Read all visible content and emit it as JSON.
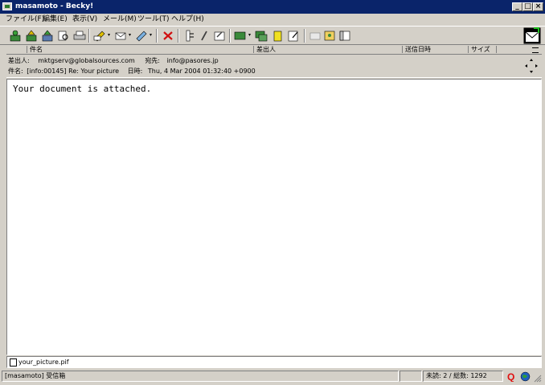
{
  "window": {
    "title": "masamoto - Becky!",
    "minimize_glyph": "_",
    "maximize_glyph": "□",
    "close_glyph": "×"
  },
  "menu": [
    {
      "label": "ファイル(F)"
    },
    {
      "label": "編集(E)"
    },
    {
      "label": "表示(V)"
    },
    {
      "label": "メール(M)"
    },
    {
      "label": "ツール(T)"
    },
    {
      "label": "ヘルプ(H)"
    }
  ],
  "toolbar": {
    "icons": [
      "receive-icon",
      "send-icon",
      "send-receive-icon",
      "print-preview-icon",
      "print-icon",
      "compose-icon",
      "reply-icon",
      "forward-icon",
      "delete-icon",
      "filter-icon",
      "edit-icon",
      "properties-icon",
      "move-icon",
      "copy-icon",
      "flag-icon",
      "note-icon",
      "mail-icon",
      "address-book-icon",
      "window-icon",
      "becky-logo-icon"
    ],
    "dropdown_glyph": "▾"
  },
  "list_header": {
    "columns": [
      {
        "label": ""
      },
      {
        "label": "件名"
      },
      {
        "label": "差出人"
      },
      {
        "label": "送信日時"
      },
      {
        "label": "サイズ"
      }
    ]
  },
  "message": {
    "from_label": "差出人:",
    "from_value": "mktgserv@globalsources.com",
    "to_label": "宛先:",
    "to_value": "info@pasores.jp",
    "subject_label": "件名:",
    "subject_value": "[info:00145] Re: Your picture",
    "date_label": "日時:",
    "date_value": "Thu, 4 Mar 2004 01:32:40 +0900",
    "body": "Your document is attached."
  },
  "attachment": {
    "filename": "your_picture.pif"
  },
  "status": {
    "folder": "[masamoto] 受信箱",
    "counts": "未読:    2 / 総数: 1292"
  },
  "colors": {
    "titlebar": "#0a246a",
    "chrome": "#d4d0c8",
    "body_bg": "#ffffff"
  }
}
